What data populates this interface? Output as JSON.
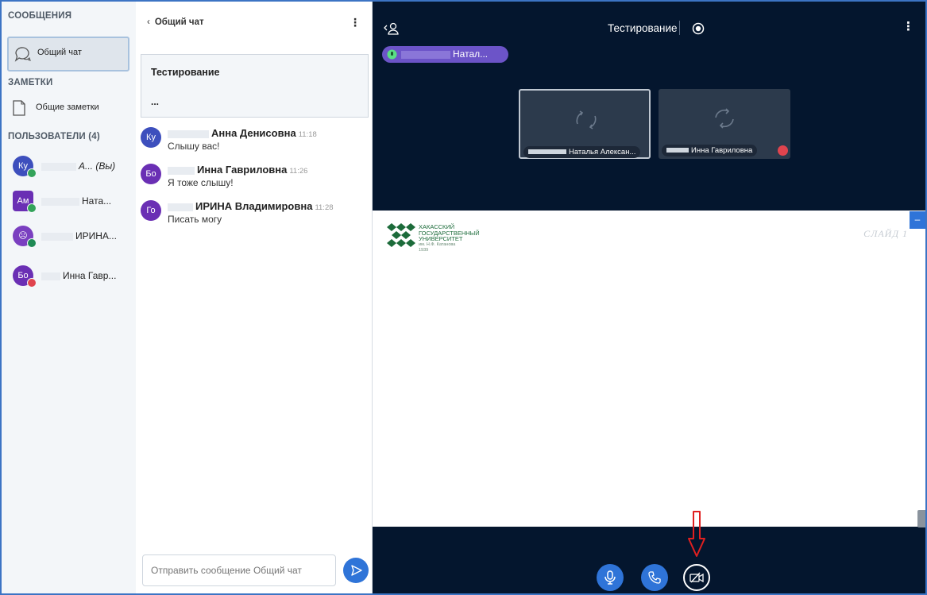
{
  "colors": {
    "accent": "#2f74d8",
    "meeting_bg": "#04162e",
    "sidebar_bg": "#f3f6f9",
    "annotation_red": "#e02020",
    "talker_purple": "#6c54c8"
  },
  "sidebar": {
    "messages_title": "СООБЩЕНИЯ",
    "chat_item": {
      "label": "Общий чат",
      "icon": "chat-bubble-icon"
    },
    "notes_title": "ЗАМЕТКИ",
    "notes_item": {
      "label": "Общие заметки",
      "icon": "notes-icon"
    },
    "users_title": "ПОЛЬЗОВАТЕЛИ (4)",
    "users": [
      {
        "initials": "Ку",
        "name_suffix": "А... (Вы)",
        "color": "#3d4fbd",
        "badge": "#33a35a",
        "shape": "circle"
      },
      {
        "initials": "Ам",
        "name_suffix": "Ната...",
        "color": "#6a2fb4",
        "badge": "#33a35a",
        "shape": "square"
      },
      {
        "initials": "☹",
        "name_suffix": "ИРИНА...",
        "color": "#7a3fc0",
        "badge": "#1f8a55",
        "shape": "circle"
      },
      {
        "initials": "Бо",
        "name_suffix": "Инна Гавр...",
        "color": "#6a2fb4",
        "badge": "#e0444e",
        "shape": "circle"
      }
    ]
  },
  "chat": {
    "header": "Общий чат",
    "back_icon": "chevron-left-icon",
    "menu_icon": "more-vertical-icon",
    "welcome_title": "Тестирование",
    "welcome_text": "...",
    "messages": [
      {
        "initials": "Ку",
        "name": "Анна Денисовна",
        "time": "11:18",
        "text": "Слышу вас!",
        "color": "#3d4fbd"
      },
      {
        "initials": "Бо",
        "name": "Инна Гавриловна",
        "time": "11:26",
        "text": "Я тоже слышу!",
        "color": "#6a2fb4"
      },
      {
        "initials": "Го",
        "name": "ИРИНА Владимировна",
        "time": "11:28",
        "text": "Писать могу",
        "color": "#6a2fb4"
      }
    ],
    "input_placeholder": "Отправить сообщение Общий чат",
    "send_icon": "send-icon"
  },
  "meeting": {
    "title": "Тестирование",
    "talker_label": "Натал...",
    "tiles": [
      {
        "name": "Наталья Алексан...",
        "muted": false
      },
      {
        "name": "Инна Гавриловна",
        "muted": true
      }
    ],
    "slide_label": "СЛАЙД 1",
    "university": {
      "line1": "ХАКАССКИЙ",
      "line2": "ГОСУДАРСТВЕННЫЙ",
      "line3": "УНИВЕРСИТЕТ",
      "line4": "им. Н.Ф. Катанова",
      "line5": "1939"
    },
    "controls": [
      "microphone-icon",
      "phone-icon",
      "camera-off-icon"
    ]
  }
}
